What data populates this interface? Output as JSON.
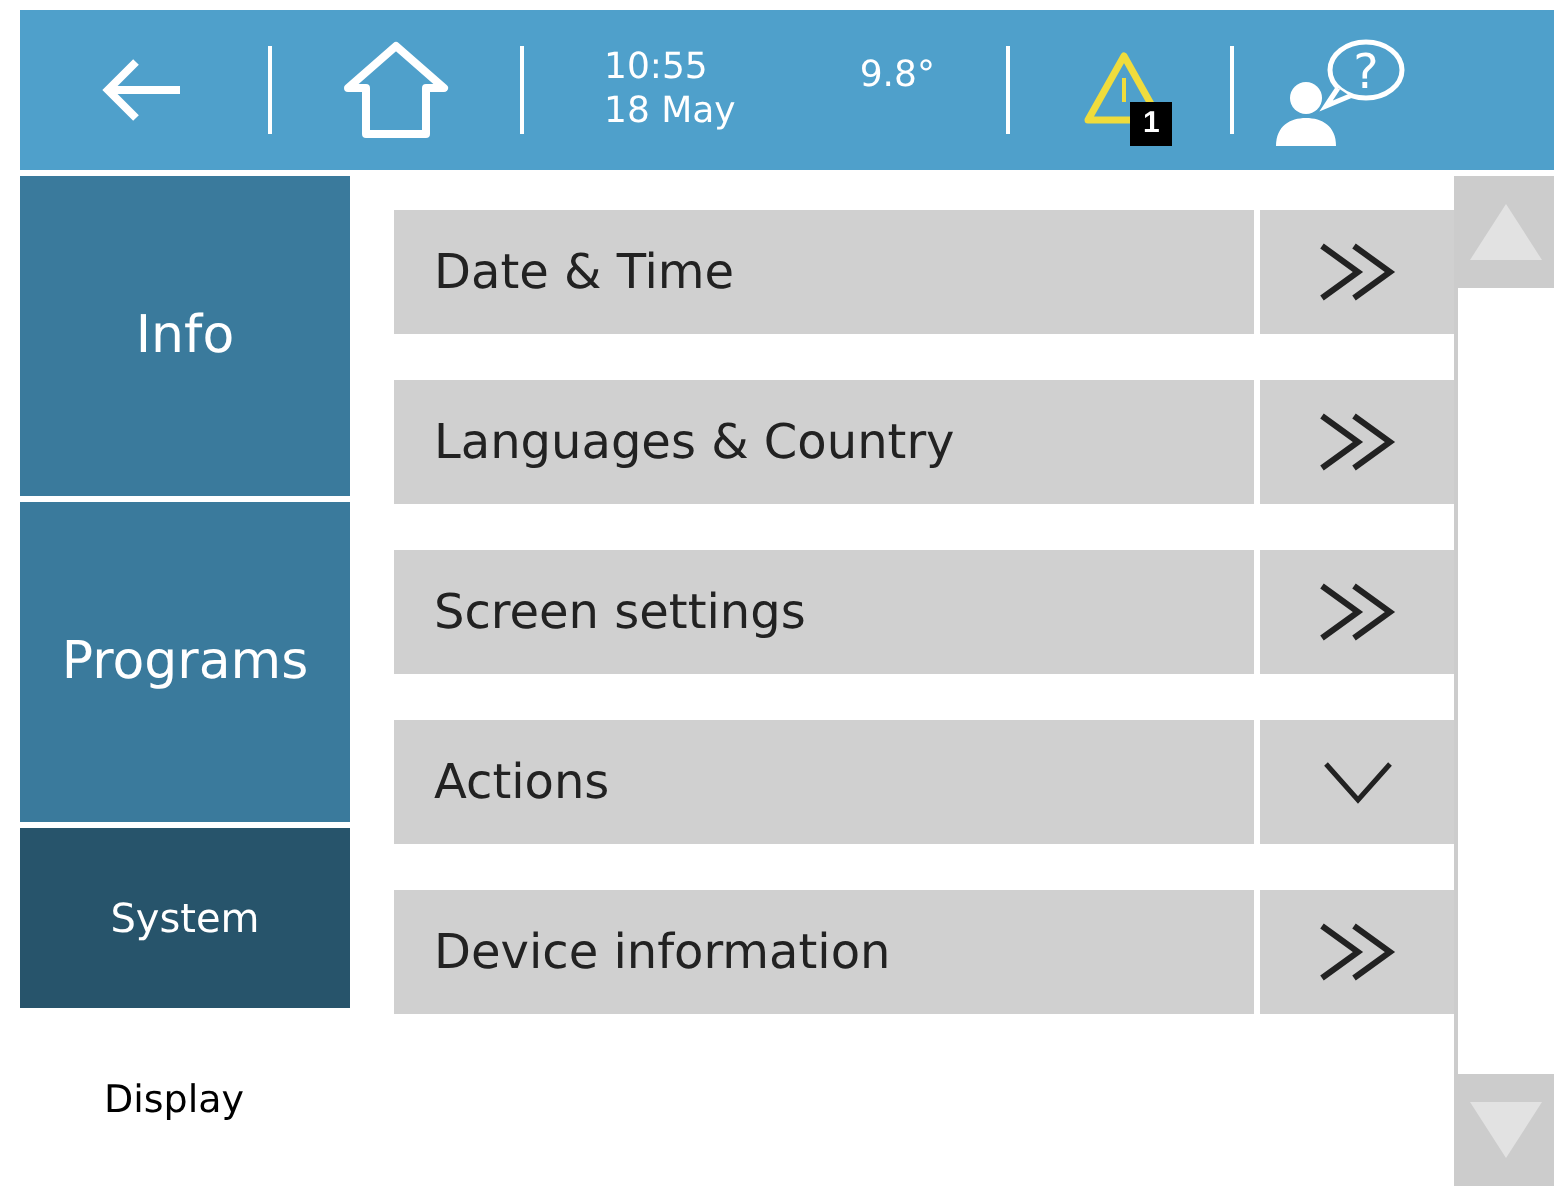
{
  "top_bar": {
    "time": "10:55",
    "date": "18 May",
    "temperature": "9.8°",
    "alert_count": "1",
    "help_symbol": "?"
  },
  "sidebar": {
    "items": [
      {
        "label": "Info",
        "selected": false
      },
      {
        "label": "Programs",
        "selected": false
      },
      {
        "label": "System",
        "selected": true
      }
    ],
    "sub_label": "Display"
  },
  "menu": [
    {
      "label": "Date & Time",
      "kind": "link"
    },
    {
      "label": "Languages & Country",
      "kind": "link"
    },
    {
      "label": "Screen settings",
      "kind": "link"
    },
    {
      "label": "Actions",
      "kind": "dropdown"
    },
    {
      "label": "Device information",
      "kind": "link"
    }
  ]
}
